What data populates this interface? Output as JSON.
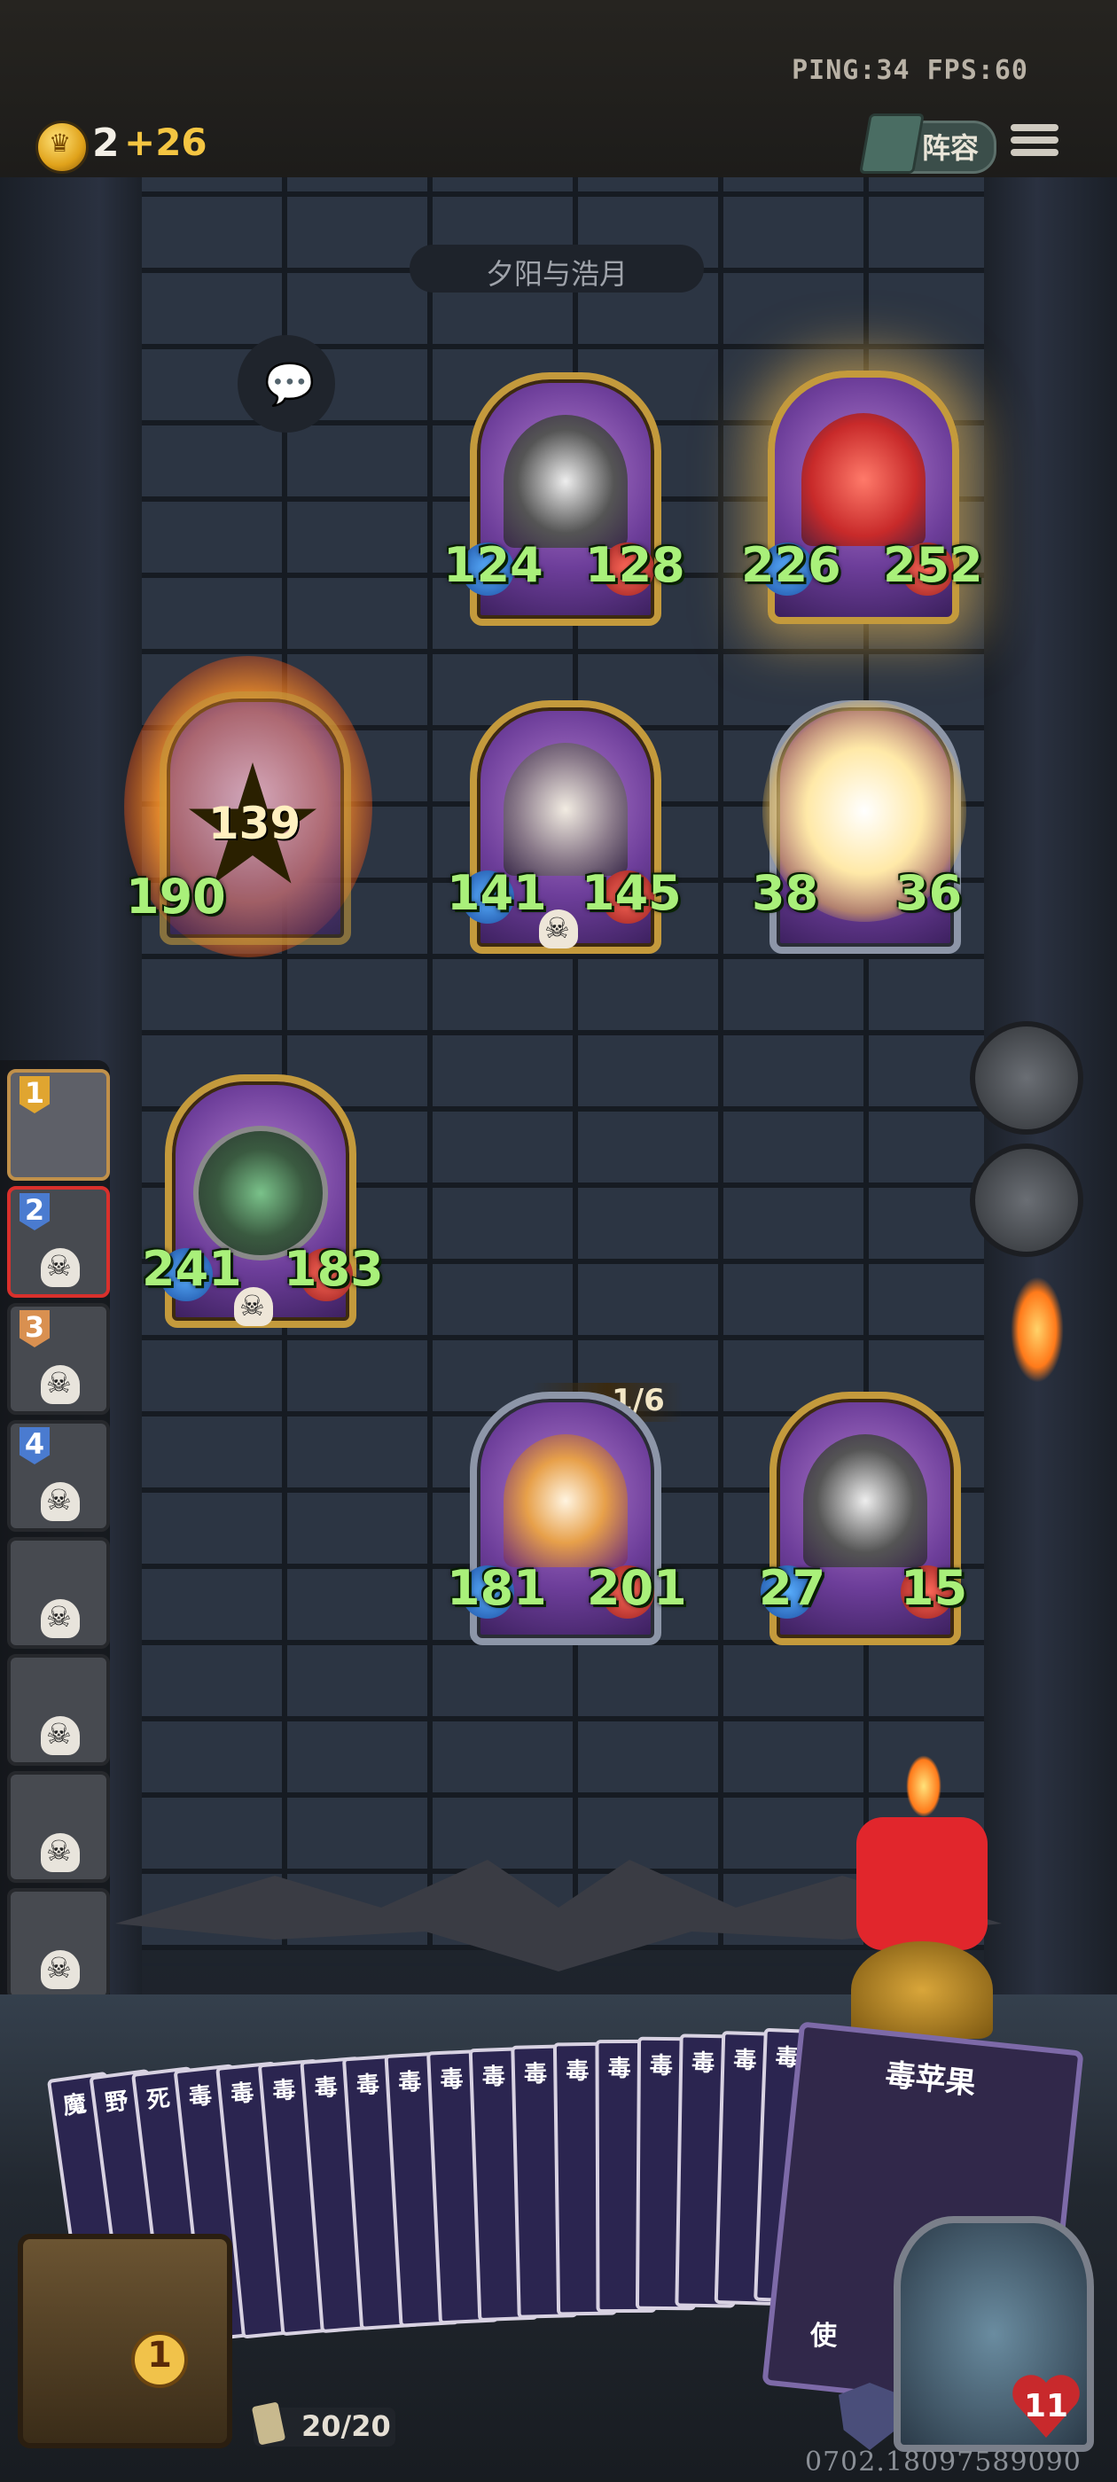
{
  "hud": {
    "ping_fps": "PING:34   FPS:60",
    "gold": "2",
    "gold_income": "+26",
    "lineup_label": "阵容"
  },
  "opponent": {
    "name": "夕阳与浩月"
  },
  "board": {
    "enemy_row1": [
      {
        "attack": "124",
        "health": "128",
        "portrait": "rabbit-samurai"
      },
      {
        "attack": "226",
        "health": "252",
        "portrait": "red-octopus"
      }
    ],
    "enemy_row2": [
      {
        "attack": "190",
        "health": "",
        "portrait": "burning-minion"
      },
      {
        "attack": "141",
        "health": "145",
        "portrait": "pumpkin-rabbit"
      },
      {
        "attack": "38",
        "health": "36",
        "portrait": "flash-minion"
      }
    ],
    "damage_popup": "139",
    "player_row1": [
      {
        "attack": "241",
        "health": "183",
        "portrait": "green-rune-crest"
      }
    ],
    "player_row2": [
      {
        "attack": "181",
        "health": "201",
        "portrait": "flaming-horse"
      },
      {
        "attack": "27",
        "health": "15",
        "portrait": "rabbit-samurai"
      }
    ],
    "horse_counter": "1/6"
  },
  "queue": [
    {
      "num": "1",
      "color": "#e0a530"
    },
    {
      "num": "2",
      "color": "#4a7bd0"
    },
    {
      "num": "3",
      "color": "#d99050"
    },
    {
      "num": "4",
      "color": "#4a7bd0"
    },
    {
      "num": ""
    },
    {
      "num": ""
    },
    {
      "num": ""
    },
    {
      "num": ""
    }
  ],
  "hand": {
    "card_labels": [
      "魔",
      "野",
      "死",
      "毒",
      "毒",
      "毒",
      "毒",
      "毒",
      "毒",
      "毒",
      "毒",
      "毒",
      "毒",
      "毒",
      "毒",
      "毒",
      "毒",
      "毒"
    ],
    "featured_card": "毒苹果",
    "featured_caption": "使"
  },
  "chest_count": "1",
  "deck_count": "20/20",
  "hero_health": "11",
  "coordinates": "0702.18097589090"
}
